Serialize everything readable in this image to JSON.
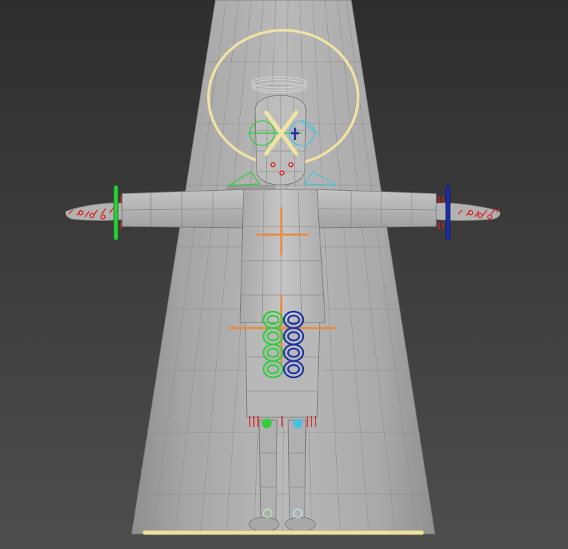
{
  "viewport": {
    "background_top": "#2e2e2e",
    "background_bottom": "#4d4d4d"
  },
  "scene": {
    "mesh_color": "#b6b6b6",
    "mesh_shade_color": "#9a9a9a",
    "wire_color": "#6d6d6d",
    "halo_color": "#eee2a4",
    "center_gizmo_color": "#e88a3c",
    "left_control_color": "#2fcf3c",
    "right_control_color": "#1a2fa8",
    "right_face_control_color": "#49c0e0",
    "finger_helper_color": "#e21b1b",
    "face_x_control_color": "#eee2a4"
  }
}
